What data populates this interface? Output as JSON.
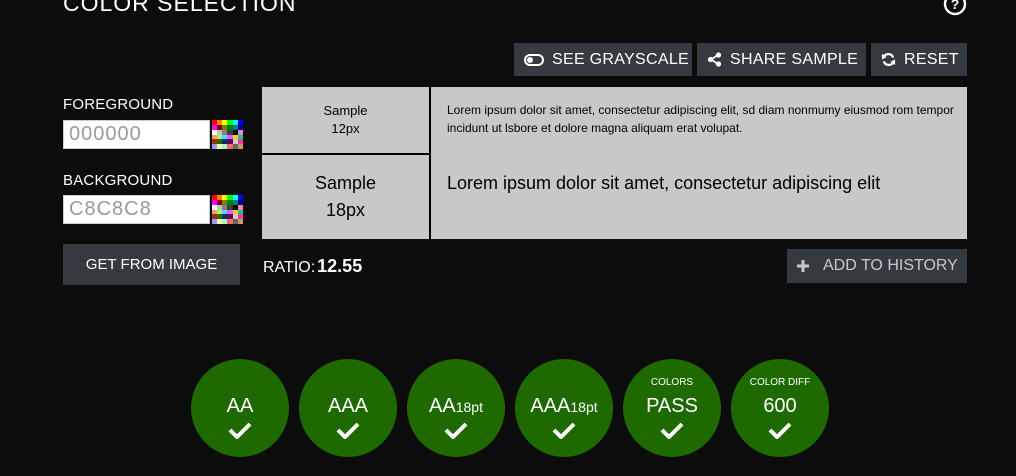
{
  "header": {
    "title": "COLOR SELECTION",
    "help_icon": "question-circle-icon"
  },
  "toolbar": {
    "grayscale_label": "SEE GRAYSCALE",
    "share_label": "SHARE SAMPLE",
    "reset_label": "RESET"
  },
  "foreground": {
    "label": "FOREGROUND",
    "value": "000000"
  },
  "background": {
    "label": "BACKGROUND",
    "value": "C8C8C8"
  },
  "sample": {
    "small_label_line1": "Sample",
    "small_label_line2": "12px",
    "large_label_line1": "Sample",
    "large_label_line2": "18px",
    "small_text": "Lorem ipsum dolor sit amet, consectetur adipiscing elit, sd diam nonmumy eiusmod rom tempor incidunt ut lsbore et dolore magna aliquam erat volupat.",
    "large_text": "Lorem ipsum dolor sit amet, consectetur adipiscing elit",
    "text_color": "#000000",
    "bg_color": "#C8C8C8"
  },
  "actions": {
    "get_from_image_label": "GET FROM IMAGE",
    "add_history_label": "ADD TO HISTORY"
  },
  "ratio": {
    "label": "RATIO:",
    "value": "12.55"
  },
  "results": [
    {
      "top": "",
      "main": "AA",
      "sub": "",
      "status": "pass"
    },
    {
      "top": "",
      "main": "AAA",
      "sub": "",
      "status": "pass"
    },
    {
      "top": "",
      "main": "AA",
      "sub": "18pt",
      "status": "pass"
    },
    {
      "top": "",
      "main": "AAA",
      "sub": "18pt",
      "status": "pass"
    },
    {
      "top": "COLORS",
      "main": "PASS",
      "sub": "",
      "status": "pass"
    },
    {
      "top": "COLOR DIFF",
      "main": "600",
      "sub": "",
      "status": "pass"
    }
  ],
  "colors": {
    "accent_pass": "#1e6a00",
    "button_bg": "#343a40",
    "page_bg": "#0c0c0d"
  }
}
